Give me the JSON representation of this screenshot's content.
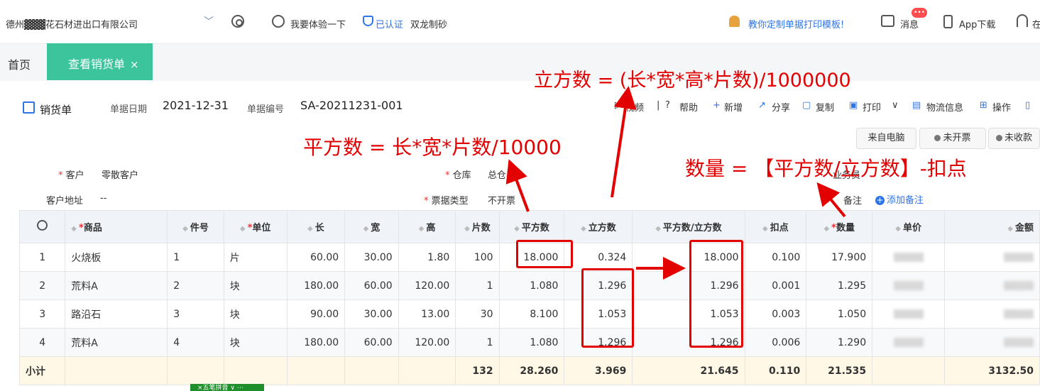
{
  "topbar": {
    "company": "德州▓▓▓花石材进出口有限公司",
    "company_caret": "﹀",
    "trial": "我要体验一下",
    "verified": "已认证",
    "store": "双龙制砂",
    "promo": "教你定制单据打印模板!",
    "messages": "消息",
    "messages_badge": "•••",
    "app_download": "App下载",
    "online": "在"
  },
  "tabs": {
    "home": "首页",
    "active": "查看销货单",
    "close": "×"
  },
  "document": {
    "title": "销货单",
    "date_label": "单据日期",
    "date_value": "2021-12-31",
    "number_label": "单据编号",
    "number_value": "SA-20211231-001"
  },
  "toolbar": {
    "video": "视频",
    "help": "帮助",
    "new": "新增",
    "share": "分享",
    "copy": "复制",
    "print": "打印",
    "print_caret": "∨",
    "logistics": "物流信息",
    "operations": "操作"
  },
  "status": {
    "source": "来自电脑",
    "invoice": "未开票",
    "payment": "未收款"
  },
  "form": {
    "customer_label": "客户",
    "customer_value": "零散客户",
    "warehouse_label": "仓库",
    "warehouse_value": "总仓",
    "salesperson_label": "业务员",
    "address_label": "客户地址",
    "address_value": "--",
    "ticket_type_label": "票据类型",
    "ticket_type_value": "不开票",
    "remark_label": "备注",
    "add_remark": "添加备注"
  },
  "annotations": {
    "volume": "立方数 = (长*宽*高*片数)/1000000",
    "area": "平方数 = 长*宽*片数/10000",
    "quantity": "数量 = 【平方数/立方数】-扣点"
  },
  "table": {
    "headers": [
      "商品",
      "件号",
      "单位",
      "长",
      "宽",
      "高",
      "片数",
      "平方数",
      "立方数",
      "平方数/立方数",
      "扣点",
      "数量",
      "单价",
      "金额"
    ],
    "rows": [
      {
        "no": "1",
        "product": "火烧板",
        "piece": "1",
        "unit": "片",
        "length": "60.00",
        "width": "30.00",
        "height": "1.80",
        "slices": "100",
        "area": "18.000",
        "volume": "0.324",
        "area_volume": "18.000",
        "deduction": "0.100",
        "quantity": "17.900"
      },
      {
        "no": "2",
        "product": "荒料A",
        "piece": "2",
        "unit": "块",
        "length": "180.00",
        "width": "60.00",
        "height": "120.00",
        "slices": "1",
        "area": "1.080",
        "volume": "1.296",
        "area_volume": "1.296",
        "deduction": "0.001",
        "quantity": "1.295"
      },
      {
        "no": "3",
        "product": "路沿石",
        "piece": "3",
        "unit": "块",
        "length": "90.00",
        "width": "30.00",
        "height": "13.00",
        "slices": "30",
        "area": "8.100",
        "volume": "1.053",
        "area_volume": "1.053",
        "deduction": "0.003",
        "quantity": "1.050"
      },
      {
        "no": "4",
        "product": "荒料A",
        "piece": "4",
        "unit": "块",
        "length": "180.00",
        "width": "60.00",
        "height": "120.00",
        "slices": "1",
        "area": "1.080",
        "volume": "1.296",
        "area_volume": "1.296",
        "deduction": "0.006",
        "quantity": "1.290"
      }
    ],
    "subtotal": {
      "label": "小计",
      "slices": "132",
      "area": "28.260",
      "volume": "3.969",
      "area_volume": "21.645",
      "deduction": "0.110",
      "quantity": "21.535",
      "amount": "3132.50"
    }
  },
  "bottom_tag": "×五笔拼音 ∨ ⋯",
  "colors": {
    "accent_green": "#3cc49d",
    "link_blue": "#2f74e6",
    "annotation_red": "#e30000",
    "required_red": "#e33333"
  }
}
